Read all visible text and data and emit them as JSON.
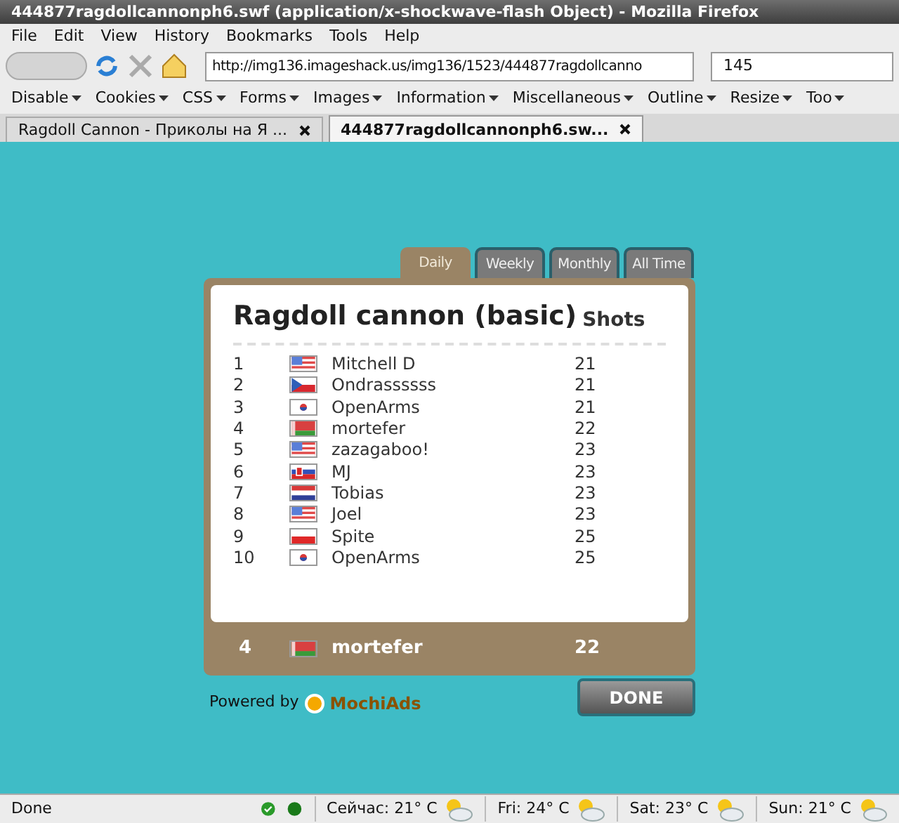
{
  "window": {
    "title": "444877ragdollcannonph6.swf (application/x-shockwave-flash Object) - Mozilla Firefox"
  },
  "menu": [
    "File",
    "Edit",
    "View",
    "History",
    "Bookmarks",
    "Tools",
    "Help"
  ],
  "address": {
    "value": "http://img136.imageshack.us/img136/1523/444877ragdollcanno"
  },
  "search": {
    "value": "145"
  },
  "toolbar": [
    "Disable",
    "Cookies",
    "CSS",
    "Forms",
    "Images",
    "Information",
    "Miscellaneous",
    "Outline",
    "Resize",
    "Too"
  ],
  "tabs": [
    {
      "label": "Ragdoll Cannon - Приколы на Я ...",
      "selected": false
    },
    {
      "label": "444877ragdollcannonph6.sw...",
      "selected": true
    }
  ],
  "board": {
    "tabs": [
      {
        "label": "Daily",
        "selected": true
      },
      {
        "label": "Weekly",
        "selected": false
      },
      {
        "label": "Monthly",
        "selected": false
      },
      {
        "label": "All Time",
        "selected": false
      }
    ],
    "title": "Ragdoll cannon (basic)",
    "column": "Shots",
    "rows": [
      {
        "rank": "1",
        "kind": "us",
        "name": "Mitchell D",
        "score": "21"
      },
      {
        "rank": "2",
        "kind": "cz",
        "name": "Ondrassssss",
        "score": "21"
      },
      {
        "rank": "3",
        "kind": "kr",
        "name": "OpenArms",
        "score": "21"
      },
      {
        "rank": "4",
        "kind": "by",
        "name": "mortefer",
        "score": "22"
      },
      {
        "rank": "5",
        "kind": "us",
        "name": "zazagaboo!",
        "score": "23"
      },
      {
        "rank": "6",
        "kind": "sk",
        "name": "MJ",
        "score": "23"
      },
      {
        "rank": "7",
        "kind": "nl",
        "name": "Tobias",
        "score": "23"
      },
      {
        "rank": "8",
        "kind": "us",
        "name": "Joel",
        "score": "23"
      },
      {
        "rank": "9",
        "kind": "pl",
        "name": "Spite",
        "score": "25"
      },
      {
        "rank": "10",
        "kind": "kr",
        "name": "OpenArms",
        "score": "25"
      }
    ],
    "player": {
      "rank": "4",
      "kind": "by",
      "name": "mortefer",
      "score": "22"
    },
    "powered_by": "Powered by",
    "brand": "MochiAds",
    "done": "DONE"
  },
  "status_bar": {
    "text": "Done",
    "weather": [
      "Сейчас: 21° C",
      "Fri: 24° C",
      "Sat: 23° C",
      "Sun: 21° C"
    ]
  }
}
